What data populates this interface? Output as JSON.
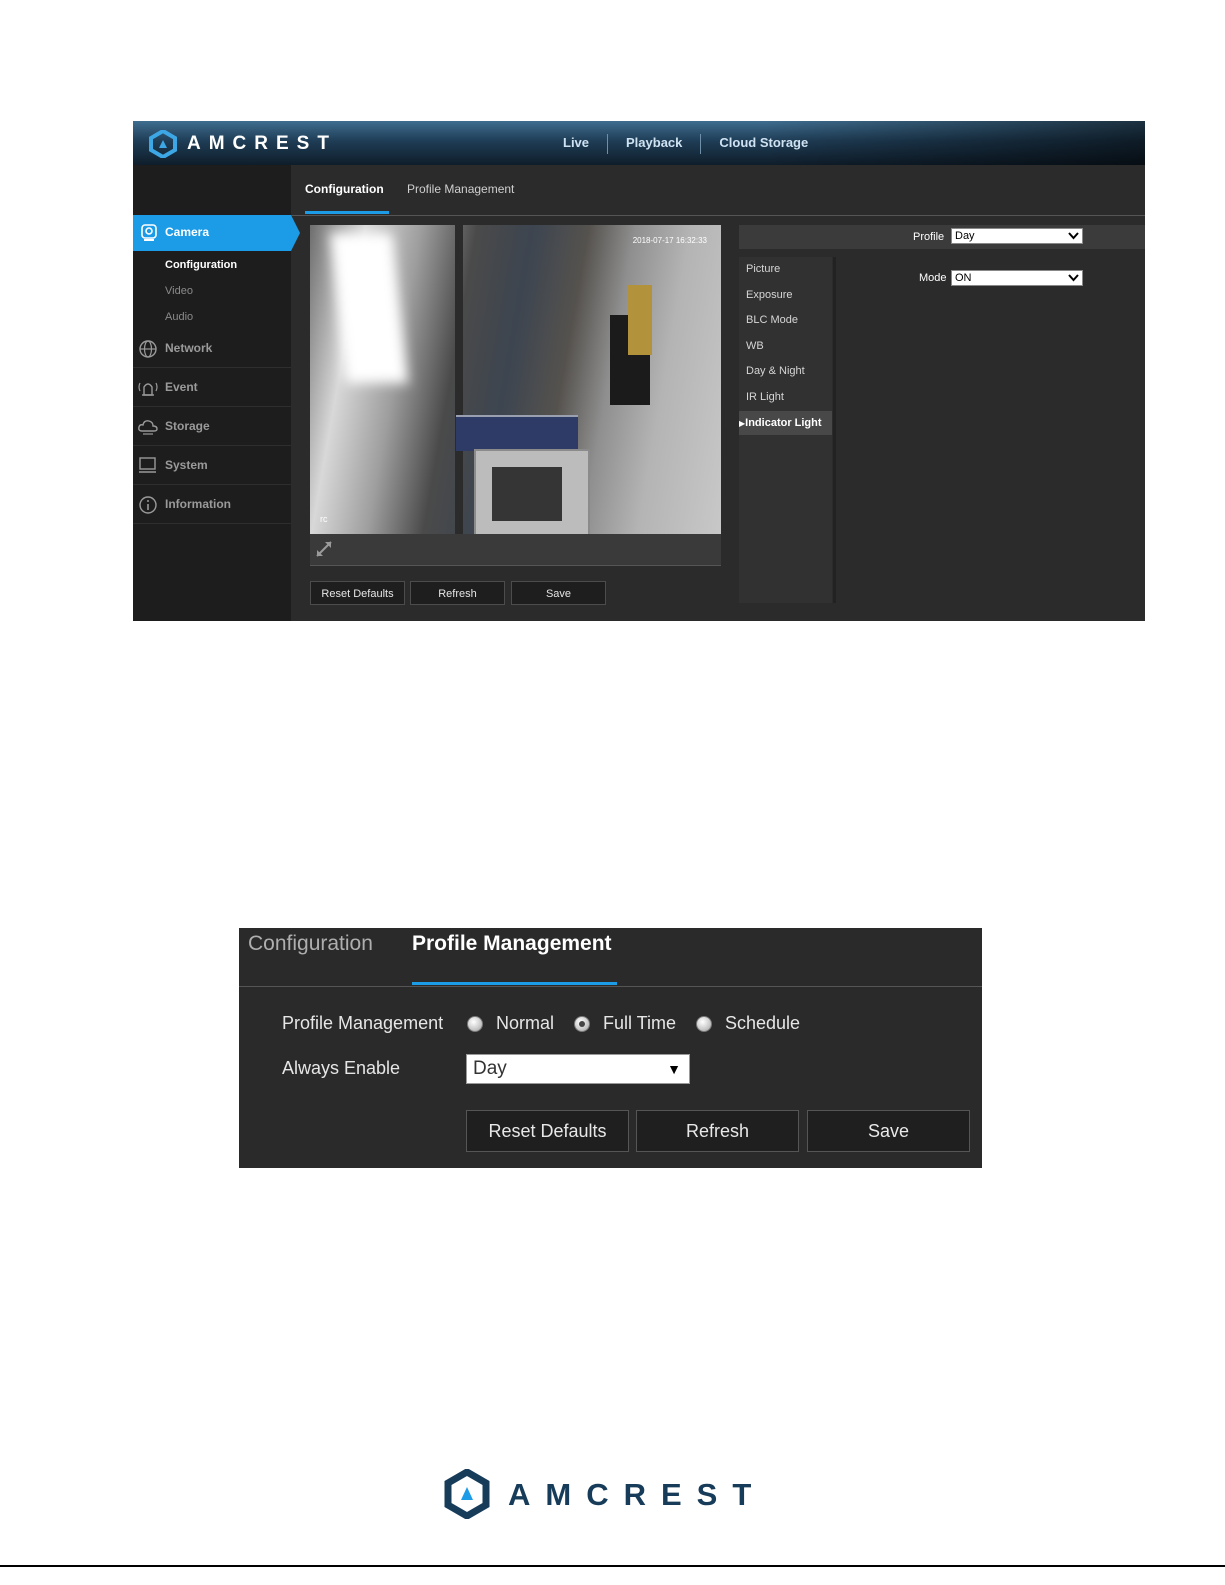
{
  "screenshot1": {
    "brand": "AMCREST",
    "top_nav": [
      "Live",
      "Playback",
      "Cloud Storage"
    ],
    "tabs": [
      "Configuration",
      "Profile Management"
    ],
    "sidebar": {
      "active": "Camera",
      "sub_items": [
        "Configuration",
        "Video",
        "Audio"
      ],
      "items": [
        "Network",
        "Event",
        "Storage",
        "System",
        "Information"
      ]
    },
    "video": {
      "timestamp": "2018-07-17 16:32:33",
      "overlay_label": "rc"
    },
    "buttons": [
      "Reset Defaults",
      "Refresh",
      "Save"
    ],
    "profile": {
      "label": "Profile",
      "value": "Day"
    },
    "mode": {
      "label": "Mode",
      "value": "ON"
    },
    "settings_menu": [
      "Picture",
      "Exposure",
      "BLC Mode",
      "WB",
      "Day & Night",
      "IR Light",
      "Indicator Light"
    ],
    "active_setting": "Indicator Light"
  },
  "screenshot2": {
    "tabs": [
      "Configuration",
      "Profile Management"
    ],
    "profile_management": {
      "label": "Profile Management",
      "options": [
        "Normal",
        "Full Time",
        "Schedule"
      ],
      "selected": "Full Time"
    },
    "always_enable": {
      "label": "Always Enable",
      "value": "Day"
    },
    "buttons": [
      "Reset Defaults",
      "Refresh",
      "Save"
    ]
  },
  "footer": {
    "brand": "AMCREST"
  },
  "colors": {
    "accent": "#1c9be6",
    "brand_dark": "#173c5a"
  }
}
